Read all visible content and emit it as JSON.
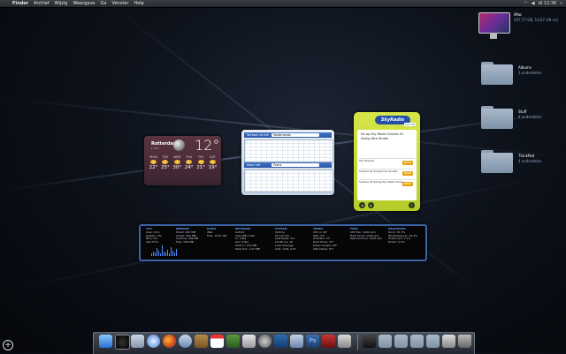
{
  "menubar": {
    "items": [
      "Finder",
      "Archief",
      "Wijzig",
      "Weergave",
      "Ga",
      "Venster",
      "Help"
    ],
    "clock": "di 12:36"
  },
  "desktop": {
    "computer": {
      "name": "iMac",
      "info": "297,77 GB, 14,67 GB vrij"
    },
    "folders": [
      {
        "name": "Albums",
        "info": "3 onderdelen"
      },
      {
        "name": "Stuff",
        "info": "4 onderdelen"
      },
      {
        "name": "ThinkPad",
        "info": "4 onderdelen"
      }
    ]
  },
  "weather": {
    "city": "Rotterdam",
    "sub": "L: 11°",
    "temp": "12°",
    "forecast": [
      {
        "day": "MON",
        "hi": "22°"
      },
      {
        "day": "TUE",
        "hi": "25°"
      },
      {
        "day": "WED",
        "hi": "30°"
      },
      {
        "day": "THU",
        "hi": "24°"
      },
      {
        "day": "FRI",
        "hi": "21°"
      },
      {
        "day": "SAT",
        "hi": "19°"
      }
    ]
  },
  "translation": {
    "from_label": "Vertaal uit het",
    "from_lang": "Nederlands",
    "to_label": "Naar het",
    "to_lang": "Frans"
  },
  "radio": {
    "logo": "SkyRadio",
    "badge": "101 FM",
    "now_playing": "Nu op Sky Radio Sultans Of Swing Dire Straits",
    "rows": [
      {
        "text": "Sky Nieuws",
        "btn": "MEER"
      },
      {
        "text": "Sultans Of Swing Dire Straits",
        "btn": "MEER"
      },
      {
        "text": "Sultans Of Swing Sky Radio Kerst",
        "btn": "MEER"
      }
    ]
  },
  "istat": {
    "cpu": {
      "title": "CPU",
      "lines": [
        "User: 11%",
        "System: 3%",
        "Nice: 0%",
        "Idle: 87%"
      ]
    },
    "memory": {
      "title": "MEMORY",
      "lines": [
        "Wired: 225 MB",
        "Active: 924 MB",
        "Inactive: 362 MB",
        "Free: 536 MB"
      ]
    },
    "disks": {
      "title": "DISKS",
      "lines": [
        "iMac",
        "Free: 14.67 GB"
      ]
    },
    "network": {
      "title": "NETWORK",
      "lines": [
        "AirPort",
        "192.168.1.100",
        "In: 0 B/s",
        "Out: 0 B/s",
        "Total In: 122 MB",
        "Total Out: 1.27 MB"
      ]
    },
    "system": {
      "title": "SYSTEM",
      "lines": [
        "Uptime",
        "9d 12h 2m",
        "Last Reset: 5m",
        "14:48, Jun 10",
        "Load Average",
        "0.61, 0.62, 0.57"
      ]
    },
    "temps": {
      "title": "TEMPS",
      "lines": [
        "CPU A: 40°",
        "GPU: 52°",
        "Ambient: 37°",
        "Hard Drive: 47°",
        "Power Supply: 38°",
        "GPU Diode: 67°"
      ]
    },
    "fans": {
      "title": "FANS",
      "lines": [
        "CPU Fan: 1200 rpm",
        "Hard Drive: 1200 rpm",
        "Optical Drive: 1200 rpm"
      ]
    },
    "processes": {
      "title": "PROCESSES",
      "lines": [
        "Dock: 70.7%",
        "WindowServer: 24.4%",
        "Firefox-bin: 2.1%",
        "Finder: 0.3%"
      ]
    }
  },
  "dock": {
    "apps": [
      "Finder",
      "Dashboard",
      "Mail",
      "Safari",
      "Firefox",
      "iTunes",
      "Address Book",
      "iCal",
      "Preview",
      "iChat",
      "System Preferences",
      "Photoshop",
      "Folders",
      "Trash"
    ]
  },
  "colors": {
    "accent": "#3c63a6",
    "radio_green": "#c8dc3a",
    "weather_bg": "#4a2c38"
  }
}
